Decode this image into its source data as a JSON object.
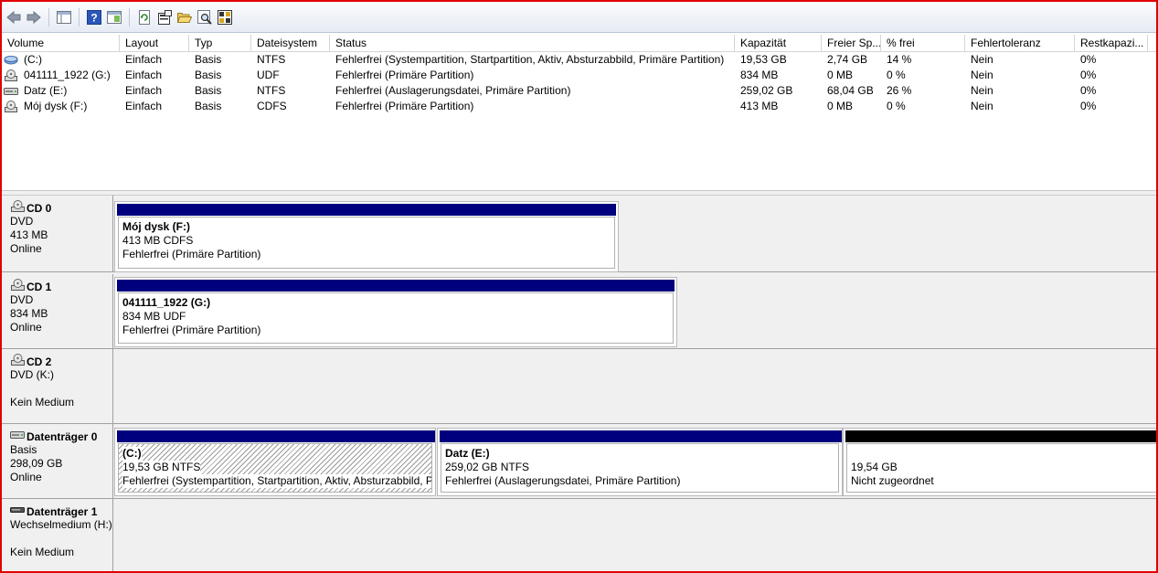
{
  "columns": [
    "Volume",
    "Layout",
    "Typ",
    "Dateisystem",
    "Status",
    "Kapazität",
    "Freier Sp...",
    "% frei",
    "Fehlertoleranz",
    "Restkapazi..."
  ],
  "volumes": [
    {
      "icon": "hard-drive-volume-icon",
      "volume": "(C:)",
      "layout": "Einfach",
      "typ": "Basis",
      "fs": "NTFS",
      "status": "Fehlerfrei (Systempartition, Startpartition, Aktiv, Absturzabbild, Primäre Partition)",
      "kap": "19,53 GB",
      "frei": "2,74 GB",
      "pct": "14 %",
      "ft": "Nein",
      "rest": "0%"
    },
    {
      "icon": "cd-drive-icon",
      "volume": "041111_1922 (G:)",
      "layout": "Einfach",
      "typ": "Basis",
      "fs": "UDF",
      "status": "Fehlerfrei (Primäre Partition)",
      "kap": "834 MB",
      "frei": "0 MB",
      "pct": "0 %",
      "ft": "Nein",
      "rest": "0%"
    },
    {
      "icon": "disk-drive-icon",
      "volume": "Datz (E:)",
      "layout": "Einfach",
      "typ": "Basis",
      "fs": "NTFS",
      "status": "Fehlerfrei (Auslagerungsdatei, Primäre Partition)",
      "kap": "259,02 GB",
      "frei": "68,04 GB",
      "pct": "26 %",
      "ft": "Nein",
      "rest": "0%"
    },
    {
      "icon": "cd-drive-icon",
      "volume": "Mój dysk (F:)",
      "layout": "Einfach",
      "typ": "Basis",
      "fs": "CDFS",
      "status": "Fehlerfrei (Primäre Partition)",
      "kap": "413 MB",
      "frei": "0 MB",
      "pct": "0 %",
      "ft": "Nein",
      "rest": "0%"
    }
  ],
  "disks": [
    {
      "name": "CD 0",
      "line1": "DVD",
      "line2": "413 MB",
      "line3": "Online",
      "partitions": [
        {
          "title": "Mój dysk  (F:)",
          "size": "413 MB CDFS",
          "status": "Fehlerfrei (Primäre Partition)"
        }
      ]
    },
    {
      "name": "CD 1",
      "line1": "DVD",
      "line2": "834 MB",
      "line3": "Online",
      "partitions": [
        {
          "title": "041111_1922  (G:)",
          "size": "834 MB UDF",
          "status": "Fehlerfrei (Primäre Partition)"
        }
      ]
    },
    {
      "name": "CD 2",
      "line1": "DVD (K:)",
      "line2": "",
      "line3": "Kein Medium",
      "partitions": []
    },
    {
      "name": "Datenträger 0",
      "line1": "Basis",
      "line2": "298,09 GB",
      "line3": "Online",
      "partitions": [
        {
          "title": "(C:)",
          "size": "19,53 GB NTFS",
          "status": "Fehlerfrei (Systempartition, Startpartition, Aktiv, Absturzabbild, P"
        },
        {
          "title": "Datz  (E:)",
          "size": "259,02 GB NTFS",
          "status": "Fehlerfrei (Auslagerungsdatei, Primäre Partition)"
        },
        {
          "title": "",
          "size": "19,54 GB",
          "status": "Nicht zugeordnet"
        }
      ]
    },
    {
      "name": "Datenträger 1",
      "line1": "Wechselmedium (H:)",
      "line2": "",
      "line3": "Kein Medium",
      "partitions": []
    }
  ],
  "colors": {
    "primary_partition_bar": "#00007f",
    "unallocated_bar": "#000000",
    "frame": "#e00000"
  }
}
